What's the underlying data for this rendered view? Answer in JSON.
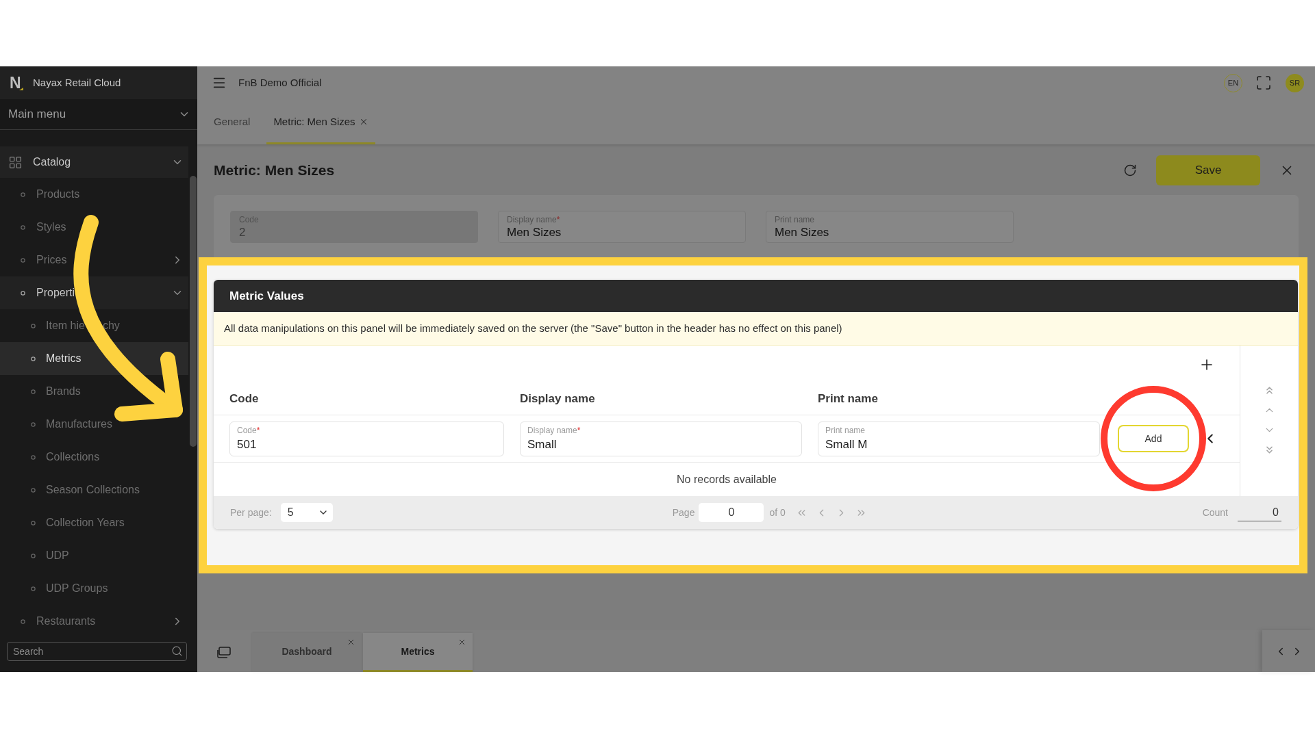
{
  "sidebar": {
    "brand": {
      "letter": "N",
      "name": "Nayax Retail Cloud"
    },
    "menu": {
      "title": "Main menu",
      "expanded": true
    },
    "items": [
      {
        "label": "Catalog",
        "selected": false,
        "expanded": true,
        "children": [
          {
            "label": "Products",
            "selected": false
          },
          {
            "label": "Styles",
            "selected": false
          },
          {
            "label": "Prices",
            "selected": false,
            "expanded": false
          },
          {
            "label": "Properti",
            "selected": false,
            "expanded": true,
            "children": [
              {
                "label_parts": [
                  "Item hie",
                  "chy"
                ],
                "selected": false
              },
              {
                "label": "Metrics",
                "selected": true
              },
              {
                "label": "Brands",
                "selected": false
              },
              {
                "label": "Manufactures",
                "selected": false
              },
              {
                "label": "Collections",
                "selected": false
              },
              {
                "label": "Season Collections",
                "selected": false
              },
              {
                "label": "Collection Years",
                "selected": false
              },
              {
                "label": "UDP",
                "selected": false
              },
              {
                "label": "UDP Groups",
                "selected": false
              }
            ]
          },
          {
            "label": "Restaurants",
            "selected": false,
            "expanded": false
          }
        ]
      }
    ],
    "search": {
      "placeholder": "Search"
    }
  },
  "header": {
    "workspace": "FnB Demo Official",
    "language": "EN",
    "user_initials": "SR"
  },
  "tabs": [
    {
      "label": "General",
      "selected": false,
      "closable": false
    },
    {
      "label": "Metric: Men Sizes",
      "selected": true,
      "closable": true
    }
  ],
  "page": {
    "title": "Metric: Men Sizes",
    "save_label": "Save",
    "fields": [
      {
        "label": "Code",
        "value": "2",
        "disabled": true
      },
      {
        "label": "Display name",
        "required_mark": "*",
        "value": "Men Sizes",
        "disabled": false
      },
      {
        "label": "Print name",
        "value": "Men Sizes",
        "disabled": false
      }
    ]
  },
  "metric_values": {
    "title": "Metric Values",
    "notice": "All data manipulations on this panel will be immediately saved on the server (the \"Save\" button in the header has no effect on this panel)",
    "columns": [
      "Code",
      "Display name",
      "Print name"
    ],
    "new_row": {
      "fields": [
        {
          "label": "Code",
          "required_mark": "*",
          "value": "501"
        },
        {
          "label": "Display name",
          "required_mark": "*",
          "value": "Small"
        },
        {
          "label": "Print name",
          "value": "Small M"
        }
      ],
      "add_label": "Add"
    },
    "empty_message": "No records available",
    "footer": {
      "per_page_label": "Per page:",
      "per_page": "5",
      "page_label": "Page",
      "page": "0",
      "page_of": "of 0",
      "count_label": "Count",
      "count": "0"
    }
  },
  "bottom_tabs": [
    {
      "label": "Dashboard",
      "selected": false,
      "closable": true
    },
    {
      "label": "Metrics",
      "selected": true,
      "closable": true
    }
  ]
}
